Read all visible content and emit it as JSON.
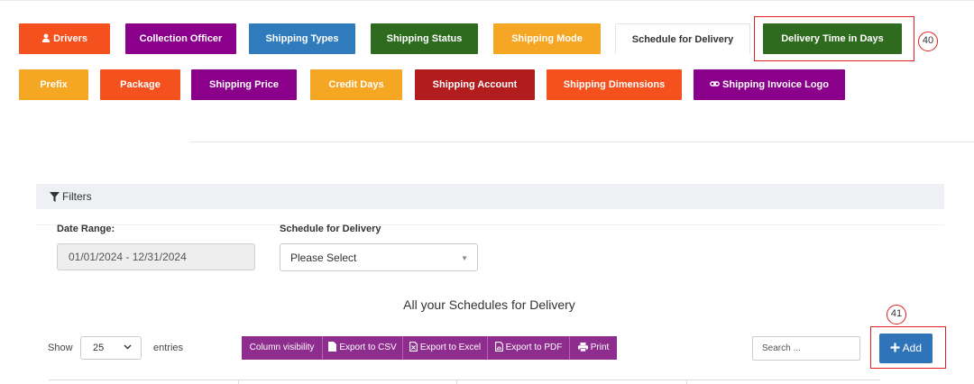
{
  "tabs_row1": [
    {
      "label": "Drivers",
      "icon": "user-icon",
      "color": "#f4511e"
    },
    {
      "label": "Collection Officer",
      "color": "#8b008b"
    },
    {
      "label": "Shipping Types",
      "color": "#2f7bbb"
    },
    {
      "label": "Shipping Status",
      "color": "#2f6b1f"
    },
    {
      "label": "Shipping Mode",
      "color": "#f5a623"
    },
    {
      "label": "Schedule for Delivery",
      "color": "#ffffff"
    },
    {
      "label": "Delivery Time in Days",
      "color": "#2f6b1f"
    }
  ],
  "tabs_row2": [
    {
      "label": "Prefix",
      "color": "#f5a623"
    },
    {
      "label": "Package",
      "color": "#f4511e"
    },
    {
      "label": "Shipping Price",
      "color": "#8b008b"
    },
    {
      "label": "Credit Days",
      "color": "#f5a623"
    },
    {
      "label": "Shipping Account",
      "color": "#b21c1c"
    },
    {
      "label": "Shipping Dimensions",
      "color": "#f4511e"
    },
    {
      "label": "Shipping Invoice Logo",
      "icon": "link-icon",
      "color": "#8b008b"
    }
  ],
  "annotations": {
    "tab_marker": "40",
    "add_marker": "41",
    "color": "#e02020"
  },
  "filters": {
    "title": "Filters",
    "date_range_label": "Date Range:",
    "date_range_value": "01/01/2024 - 12/31/2024",
    "schedule_label": "Schedule for Delivery",
    "schedule_value": "Please Select"
  },
  "table": {
    "title": "All your Schedules for Delivery",
    "show_label": "Show",
    "page_length": "25",
    "entries_label": "entries",
    "buttons": [
      "Column visibility",
      "Export to CSV",
      "Export to Excel",
      "Export to PDF",
      "Print"
    ],
    "search_placeholder": "Search ...",
    "add_label": "Add"
  }
}
